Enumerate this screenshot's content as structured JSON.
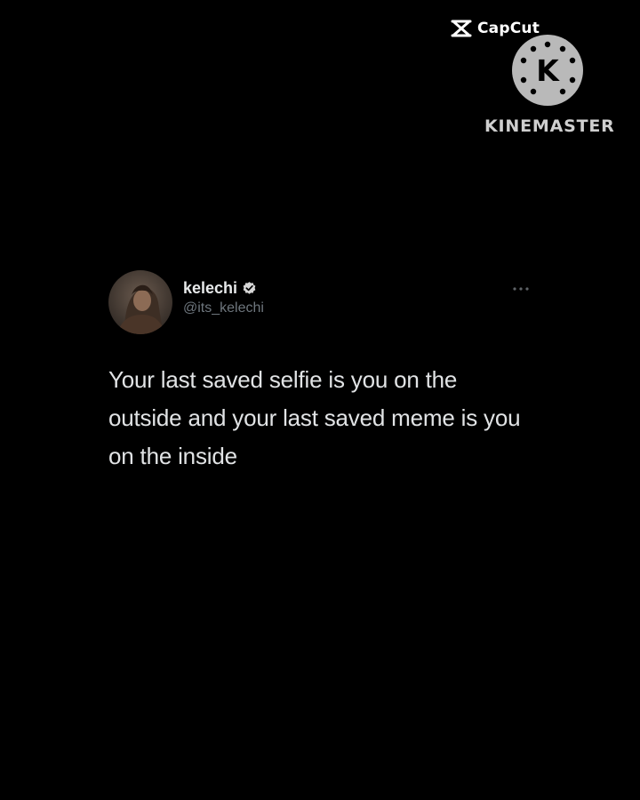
{
  "watermarks": {
    "capcut": {
      "label": "CapCut",
      "icon": "capcut-logo-icon"
    },
    "kinemaster": {
      "logo_letter": "K",
      "label": "KINEMASTER",
      "icon": "kinemaster-logo-icon"
    }
  },
  "tweet": {
    "author": {
      "display_name": "kelechi",
      "handle": "@its_kelechi",
      "verified_icon": "verified-badge-icon",
      "avatar_icon": "profile-avatar"
    },
    "more_icon": "more-options-icon",
    "text": "Your last saved selfie is you on the outside and your last saved meme is you on the inside"
  },
  "colors": {
    "background": "#000000",
    "text_primary": "#e7e9ea",
    "text_secondary": "#6e767d",
    "kinemaster_logo": "#b9b9b9"
  }
}
